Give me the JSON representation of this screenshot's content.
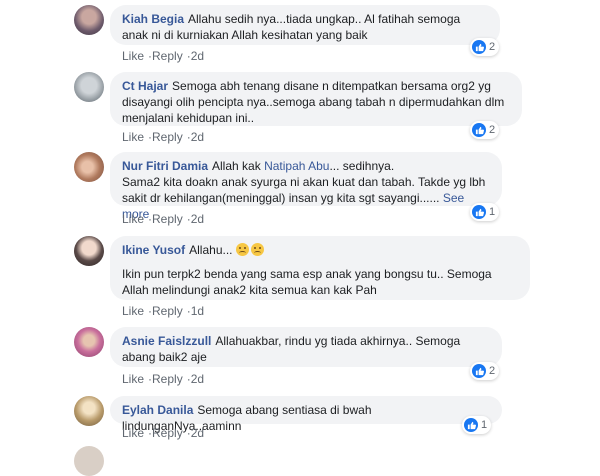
{
  "actions": {
    "like": "Like",
    "reply": "Reply",
    "sep": "·"
  },
  "see_more": "See more",
  "comments": [
    {
      "author": "Kiah Begia",
      "text": "Allahu sedih nya...tiada ungkap.. Al fatihah semoga anak ni di kurniakan Allah kesihatan yang baik",
      "time": "2d",
      "reactions": "2"
    },
    {
      "author": "Ct Hajar",
      "text": "Semoga abh tenang disane n ditempatkan bersama org2 yg disayangi olih pencipta nya..semoga abang tabah n dipermudahkan dlm menjalani kehidupan ini..",
      "time": "2d",
      "reactions": "2"
    },
    {
      "author": "Nur Fitri Damia",
      "text_prefix": "Allah kak",
      "mention": "Natipah Abu",
      "text": "... sedihnya.",
      "text2": "Sama2 kita doakn anak syurga ni akan kuat dan tabah. Takde yg lbh sakit dr kehilangan(meninggal) insan yg kita sgt sayangi......",
      "time": "2d",
      "reactions": "1"
    },
    {
      "author": "Ikine Yusof",
      "text": "Allahu...",
      "text2": "Ikin pun terpk2 benda yang sama esp anak yang bongsu tu.. Semoga Allah melindungi anak2 kita semua kan kak Pah",
      "time": "1d"
    },
    {
      "author": "Asnie Faislzzull",
      "text": "Allahuakbar, rindu yg tiada akhirnya.. Semoga abang baik2 aje",
      "time": "2d",
      "reactions": "2"
    },
    {
      "author": "Eylah Danila",
      "text": "Semoga abang sentiasa di bwah lindunganNya..aaminn",
      "time": "2d",
      "reactions": "1"
    }
  ],
  "colors": {
    "link": "#385898",
    "bubble": "#f2f3f5",
    "like_blue": "#1877f2"
  }
}
